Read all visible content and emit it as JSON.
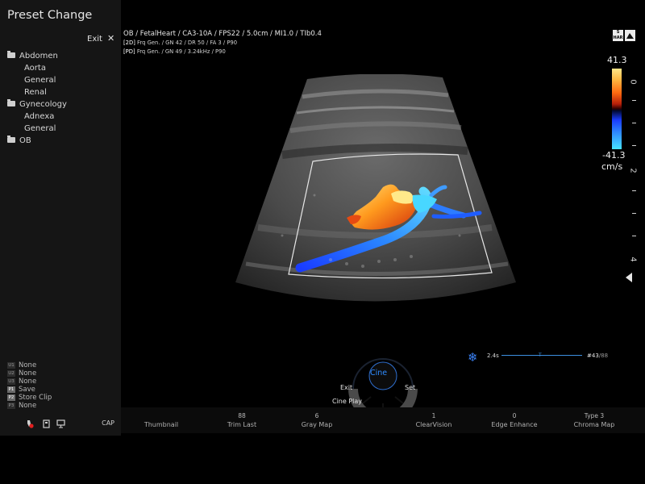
{
  "panel": {
    "title": "Preset Change",
    "exit_label": "Exit",
    "tree": [
      {
        "label": "Abdomen",
        "type": "folder"
      },
      {
        "label": "Aorta",
        "type": "item"
      },
      {
        "label": "General",
        "type": "item"
      },
      {
        "label": "Renal",
        "type": "item"
      },
      {
        "label": "Gynecology",
        "type": "folder"
      },
      {
        "label": "Adnexa",
        "type": "item"
      },
      {
        "label": "General",
        "type": "item"
      },
      {
        "label": "OB",
        "type": "folder"
      }
    ],
    "shortcuts": [
      {
        "key": "U1",
        "label": "None"
      },
      {
        "key": "U2",
        "label": "None"
      },
      {
        "key": "U3",
        "label": "None"
      },
      {
        "key": "P1",
        "label": "Save"
      },
      {
        "key": "P2",
        "label": "Store Clip"
      },
      {
        "key": "P3",
        "label": "None"
      }
    ],
    "cap_label": "CAP"
  },
  "header": {
    "line": "OB / FetalHeart / CA3-10A / FPS22 / 5.0cm / MI1.0 / TIb0.4",
    "line_2d": "Frq Gen. / GN 42 / DR 50 / FA 3 / P90",
    "tag_2d": "[2D]",
    "line_pd": "Frq Gen. / GN 49 / 3.24kHz / P90",
    "tag_pd": "[PD]"
  },
  "icons": {
    "shar": "S HAR"
  },
  "colorbar": {
    "max": "41.3",
    "min": "-41.3",
    "unit": "cm/s"
  },
  "depth": {
    "labels": [
      "0",
      "2",
      "4"
    ]
  },
  "cine": {
    "time": "2.4s",
    "marker": "T",
    "frame": "#43",
    "total": "/88",
    "dial": {
      "center": "Cine",
      "left": "Exit",
      "right": "Set",
      "bottom_left": "Cine Play"
    }
  },
  "bottom_menu": [
    {
      "value": "",
      "label": "Thumbnail"
    },
    {
      "value": "88",
      "label": "Trim Last"
    },
    {
      "value": "6",
      "label": "Gray Map"
    },
    {
      "value": "1",
      "label": "ClearVision"
    },
    {
      "value": "0",
      "label": "Edge Enhance"
    },
    {
      "value": "Type 3",
      "label": "Chroma Map"
    }
  ]
}
